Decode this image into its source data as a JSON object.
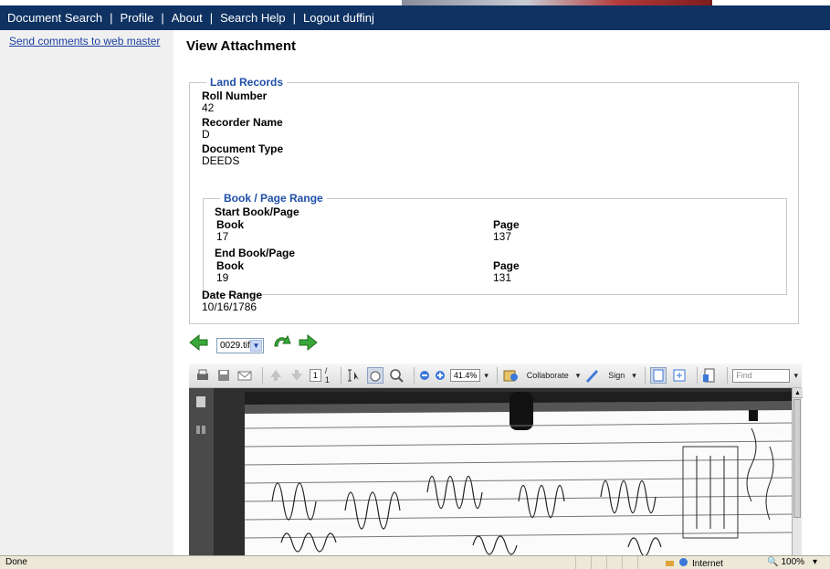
{
  "nav": {
    "items": [
      "Document Search",
      "Profile",
      "About",
      "Search Help",
      "Logout duffinj"
    ]
  },
  "sidebar": {
    "link": "Send comments to web master"
  },
  "main": {
    "title": "View Attachment",
    "land_records": {
      "legend": "Land Records",
      "roll_number_label": "Roll Number",
      "roll_number_value": "42",
      "recorder_name_label": "Recorder Name",
      "recorder_name_value": "D",
      "document_type_label": "Document Type",
      "document_type_value": "DEEDS",
      "book_page": {
        "legend": "Book / Page Range",
        "start_label": "Start Book/Page",
        "start_book_label": "Book",
        "start_book_value": "17",
        "start_page_label": "Page",
        "start_page_value": "137",
        "end_label": "End Book/Page",
        "end_book_label": "Book",
        "end_book_value": "19",
        "end_page_label": "Page",
        "end_page_value": "131"
      },
      "date_range_label": "Date Range",
      "date_range_value": "10/16/1786"
    },
    "pager": {
      "selected_file": "0029.tif"
    }
  },
  "viewer": {
    "page_current": "1",
    "page_total": "/ 1",
    "zoom": "41.4%",
    "collaborate_label": "Collaborate",
    "sign_label": "Sign",
    "find_placeholder": "Find"
  },
  "statusbar": {
    "status": "Done",
    "zone": "Internet",
    "zoom": "100%"
  },
  "colors": {
    "nav_bg": "#0f3263",
    "legend_text": "#1f4fa8",
    "link": "#1a3fa0",
    "arrow_green": "#3aa83a"
  }
}
